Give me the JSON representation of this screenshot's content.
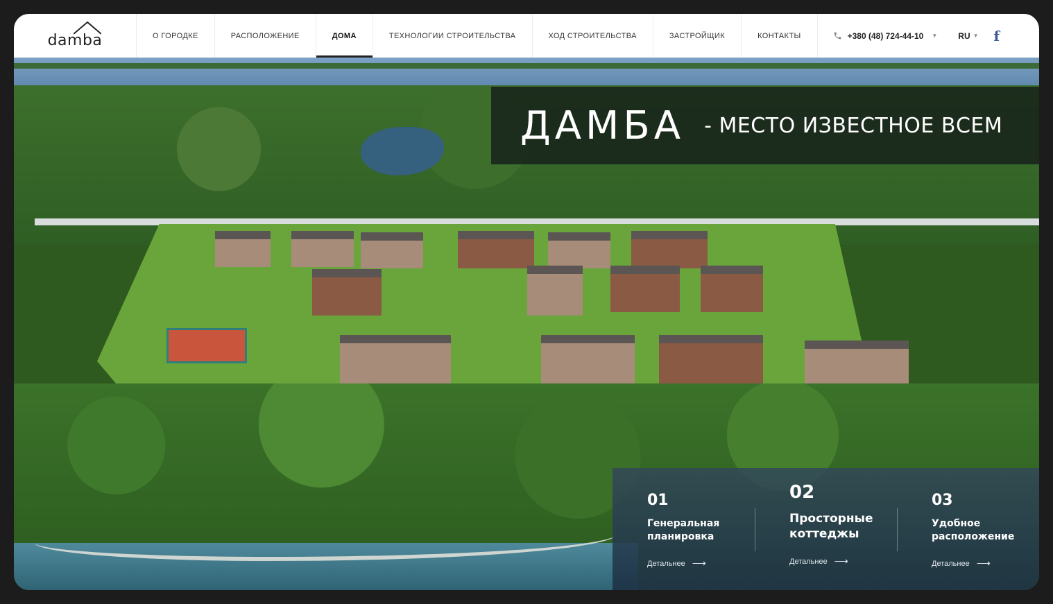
{
  "header": {
    "logo_text": "damba",
    "nav": [
      {
        "id": "about",
        "label": "О ГОРОДКЕ"
      },
      {
        "id": "location",
        "label": "РАСПОЛОЖЕНИЕ"
      },
      {
        "id": "houses",
        "label": "ДОМА",
        "active": true
      },
      {
        "id": "tech",
        "label": "ТЕХНОЛОГИИ СТРОИТЕЛЬСТВА"
      },
      {
        "id": "progress",
        "label": "ХОД СТРОИТЕЛЬСТВА"
      },
      {
        "id": "developer",
        "label": "ЗАСТРОЙЩИК"
      },
      {
        "id": "contacts",
        "label": "КОНТАКТЫ"
      }
    ],
    "phone": "+380 (48) 724-44-10",
    "language": "RU",
    "social_icon": "facebook-icon"
  },
  "hero": {
    "brand": "ДАМБА",
    "tagline": "- МЕСТО ИЗВЕСТНОЕ ВСЕМ"
  },
  "features": [
    {
      "num": "01",
      "title": "Генеральная планировка",
      "more": "Детальнее"
    },
    {
      "num": "02",
      "title": "Просторные коттеджы",
      "more": "Детальнее"
    },
    {
      "num": "03",
      "title": "Удобное расположение",
      "more": "Детальнее"
    }
  ],
  "colors": {
    "accent_text": "#ffffff",
    "facebook": "#3b5998",
    "header_bg": "#ffffff"
  }
}
